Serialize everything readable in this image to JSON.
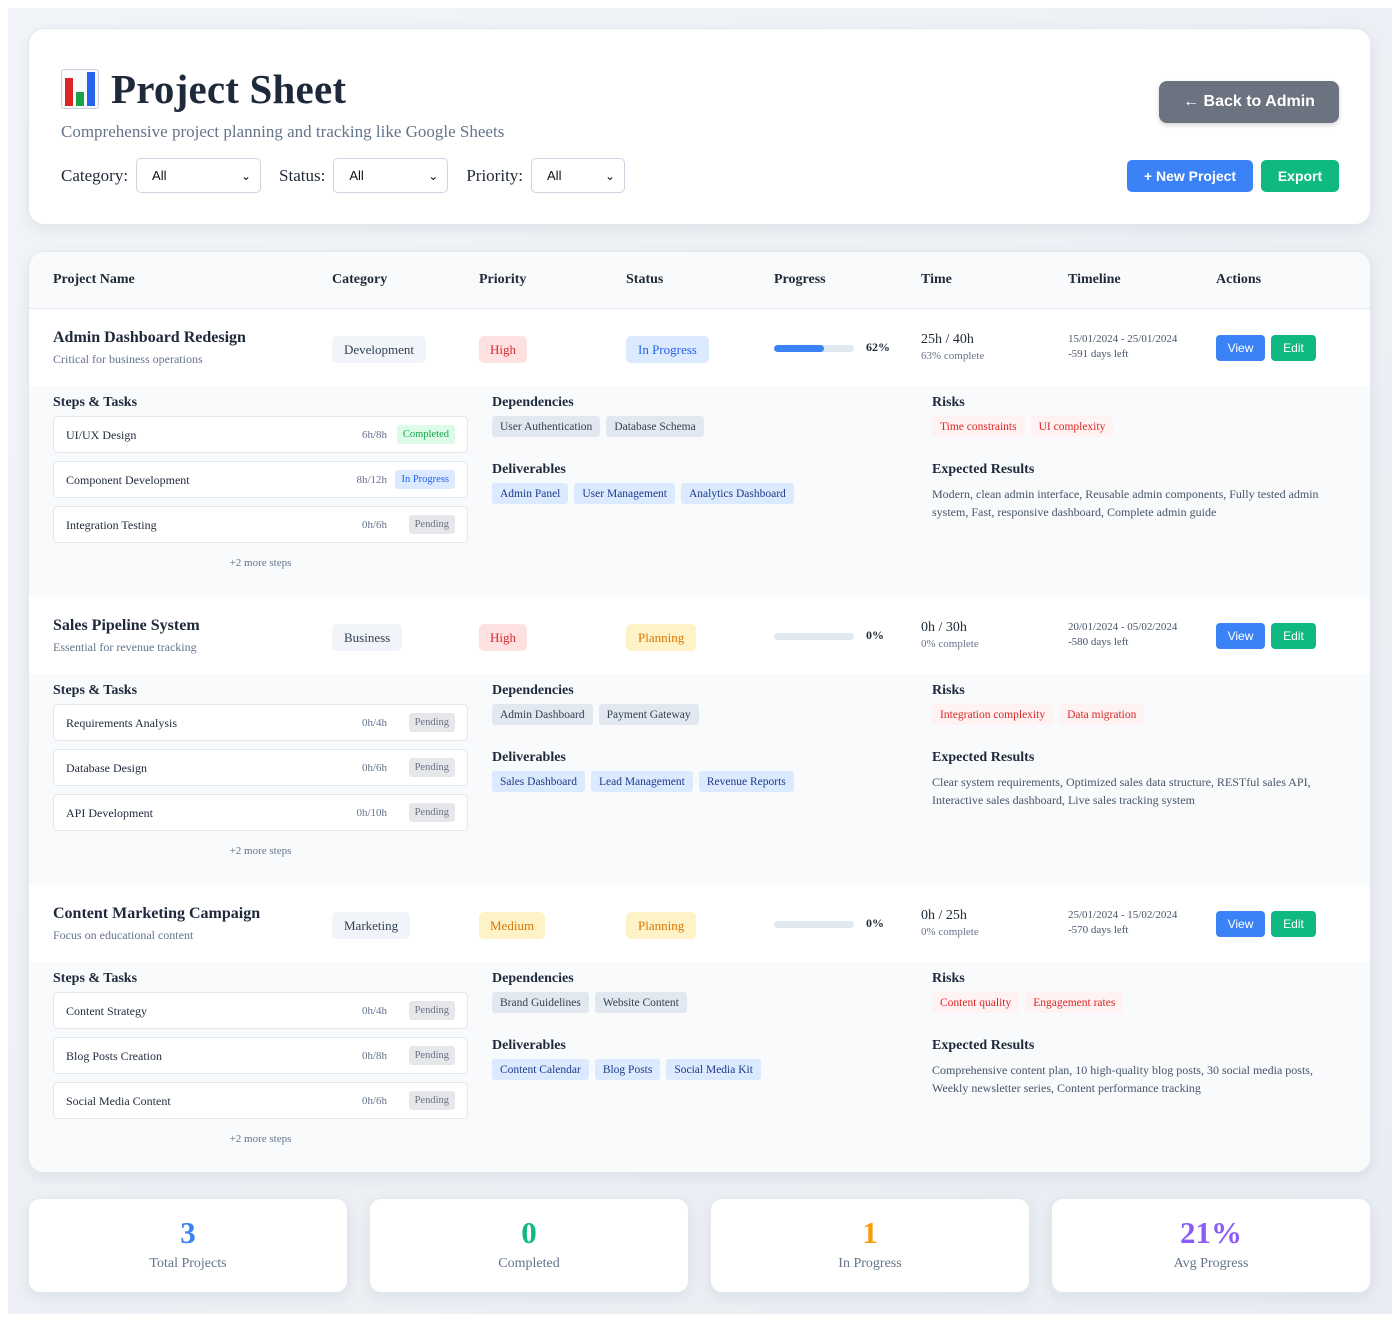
{
  "header": {
    "icon": "bar-chart-icon",
    "title": "Project Sheet",
    "subtitle": "Comprehensive project planning and tracking like Google Sheets",
    "back_label": "← Back to Admin",
    "new_label": "+ New Project",
    "export_label": "Export",
    "filters": [
      {
        "label": "Category:",
        "value": "All"
      },
      {
        "label": "Status:",
        "value": "All"
      },
      {
        "label": "Priority:",
        "value": "All"
      }
    ]
  },
  "columns": [
    "Project Name",
    "Category",
    "Priority",
    "Status",
    "Progress",
    "Time",
    "Timeline",
    "Actions"
  ],
  "labels": {
    "steps": "Steps & Tasks",
    "dependencies": "Dependencies",
    "deliverables": "Deliverables",
    "risks": "Risks",
    "results": "Expected Results",
    "view": "View",
    "edit": "Edit"
  },
  "projects": [
    {
      "name": "Admin Dashboard Redesign",
      "desc": "Critical for business operations",
      "category": "Development",
      "priority": "High",
      "status": "In Progress",
      "progress": 62,
      "progress_label": "62%",
      "hours": "25h / 40h",
      "hours_complete": "63% complete",
      "dates": "15/01/2024 - 25/01/2024",
      "days_left": "-591 days left",
      "steps": [
        {
          "name": "UI/UX Design",
          "hours": "6h/8h",
          "status": "Completed"
        },
        {
          "name": "Component Development",
          "hours": "8h/12h",
          "status": "In Progress"
        },
        {
          "name": "Integration Testing",
          "hours": "0h/6h",
          "status": "Pending"
        }
      ],
      "more_steps": "+2 more steps",
      "dependencies": [
        "User Authentication",
        "Database Schema"
      ],
      "deliverables": [
        "Admin Panel",
        "User Management",
        "Analytics Dashboard"
      ],
      "risks": [
        "Time constraints",
        "UI complexity"
      ],
      "results": "Modern, clean admin interface, Reusable admin components, Fully tested admin system, Fast, responsive dashboard, Complete admin guide"
    },
    {
      "name": "Sales Pipeline System",
      "desc": "Essential for revenue tracking",
      "category": "Business",
      "priority": "High",
      "status": "Planning",
      "progress": 0,
      "progress_label": "0%",
      "hours": "0h / 30h",
      "hours_complete": "0% complete",
      "dates": "20/01/2024 - 05/02/2024",
      "days_left": "-580 days left",
      "steps": [
        {
          "name": "Requirements Analysis",
          "hours": "0h/4h",
          "status": "Pending"
        },
        {
          "name": "Database Design",
          "hours": "0h/6h",
          "status": "Pending"
        },
        {
          "name": "API Development",
          "hours": "0h/10h",
          "status": "Pending"
        }
      ],
      "more_steps": "+2 more steps",
      "dependencies": [
        "Admin Dashboard",
        "Payment Gateway"
      ],
      "deliverables": [
        "Sales Dashboard",
        "Lead Management",
        "Revenue Reports"
      ],
      "risks": [
        "Integration complexity",
        "Data migration"
      ],
      "results": "Clear system requirements, Optimized sales data structure, RESTful sales API, Interactive sales dashboard, Live sales tracking system"
    },
    {
      "name": "Content Marketing Campaign",
      "desc": "Focus on educational content",
      "category": "Marketing",
      "priority": "Medium",
      "status": "Planning",
      "progress": 0,
      "progress_label": "0%",
      "hours": "0h / 25h",
      "hours_complete": "0% complete",
      "dates": "25/01/2024 - 15/02/2024",
      "days_left": "-570 days left",
      "steps": [
        {
          "name": "Content Strategy",
          "hours": "0h/4h",
          "status": "Pending"
        },
        {
          "name": "Blog Posts Creation",
          "hours": "0h/8h",
          "status": "Pending"
        },
        {
          "name": "Social Media Content",
          "hours": "0h/6h",
          "status": "Pending"
        }
      ],
      "more_steps": "+2 more steps",
      "dependencies": [
        "Brand Guidelines",
        "Website Content"
      ],
      "deliverables": [
        "Content Calendar",
        "Blog Posts",
        "Social Media Kit"
      ],
      "risks": [
        "Content quality",
        "Engagement rates"
      ],
      "results": "Comprehensive content plan, 10 high-quality blog posts, 30 social media posts, Weekly newsletter series, Content performance tracking"
    }
  ],
  "stats": [
    {
      "value": "3",
      "label": "Total Projects",
      "color": "#3b82f6"
    },
    {
      "value": "0",
      "label": "Completed",
      "color": "#10b981"
    },
    {
      "value": "1",
      "label": "In Progress",
      "color": "#f59e0b"
    },
    {
      "value": "21%",
      "label": "Avg Progress",
      "color": "#8b5cf6"
    }
  ],
  "colors": {
    "priority": {
      "High": [
        "#fee2e2",
        "#dc2626"
      ],
      "Medium": [
        "#fef3c7",
        "#d97706"
      ]
    },
    "status": {
      "In Progress": [
        "#dbeafe",
        "#2563eb"
      ],
      "Planning": [
        "#fef3c7",
        "#d97706"
      ]
    },
    "step_status": {
      "Completed": [
        "#dcfce7",
        "#16a34a"
      ],
      "In Progress": [
        "#dbeafe",
        "#2563eb"
      ],
      "Pending": [
        "#e5e7eb",
        "#6b7280"
      ]
    }
  }
}
